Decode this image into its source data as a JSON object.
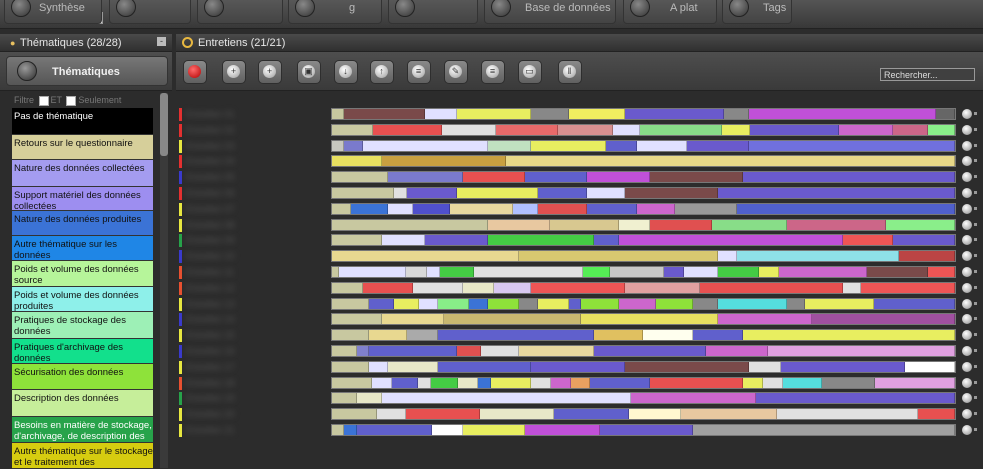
{
  "top": {
    "input_value": "",
    "buttons": [
      {
        "label": "Synthèse"
      },
      {
        "label": ""
      },
      {
        "label": ""
      },
      {
        "label": "g"
      },
      {
        "label": ""
      },
      {
        "label": "Base de données"
      },
      {
        "label": "A plat"
      },
      {
        "label": "Tags"
      }
    ]
  },
  "left": {
    "header": "Thématiques (28/28)",
    "minimize": "-",
    "toolbar_label": "Thématiques",
    "filter_label": "Filtre",
    "filter_and": "ET",
    "filter_only": "Seulement",
    "items": [
      {
        "label": "Pas de thématique",
        "color": "#000000",
        "text": "#ffffff"
      },
      {
        "label": "Retours sur le questionnaire",
        "color": "#d6cf9a",
        "text": "#111111"
      },
      {
        "label": "Nature des données collectées",
        "color": "#a49cf0",
        "text": "#111111"
      },
      {
        "label": "Support matériel des données collectées",
        "color": "#9d8ef0",
        "text": "#111111"
      },
      {
        "label": "Nature des données produites",
        "color": "#3b73d6",
        "text": "#111111"
      },
      {
        "label": "Autre thématique sur les données",
        "color": "#1f86e6",
        "text": "#111111"
      },
      {
        "label": "Poids et volume des données source",
        "color": "#b6f59a",
        "text": "#111111"
      },
      {
        "label": "Poids et volume des données produites",
        "color": "#8ef0ea",
        "text": "#111111"
      },
      {
        "label": "Pratiques de stockage des données",
        "color": "#9df0b6",
        "text": "#111111"
      },
      {
        "label": "Pratiques d'archivage des données",
        "color": "#12e08c",
        "text": "#111111"
      },
      {
        "label": "Sécurisation des données",
        "color": "#8ee23a",
        "text": "#111111"
      },
      {
        "label": "Description des données",
        "color": "#c6ee9a",
        "text": "#111111"
      },
      {
        "label": "Besoins en matière de stockage, d'archivage, de description des",
        "color": "#27a34a",
        "text": "#ffffff"
      },
      {
        "label": "Autre thématique sur le stockage et le traitement des",
        "color": "#d6cc10",
        "text": "#111111"
      }
    ]
  },
  "right": {
    "header": "Entretiens (21/21)",
    "search_placeholder": "Rechercher...",
    "toolbar_icons": [
      "record-icon",
      "zoom-in-icon",
      "add-icon",
      "document-icon",
      "download-icon",
      "upload-icon",
      "list-icon",
      "edit-icon",
      "sort-icon",
      "window-icon",
      "pause-icon"
    ],
    "rows": [
      {
        "marker": "#e53030",
        "name": "Entretien 01",
        "segs": [
          [
            "#c8c8a0",
            2
          ],
          [
            "#7a4a4a",
            13
          ],
          [
            "#e0e0ff",
            5
          ],
          [
            "#e8ee60",
            12
          ],
          [
            "#888",
            6
          ],
          [
            "#f0ee60",
            9
          ],
          [
            "#6a5acd",
            16
          ],
          [
            "#888",
            4
          ],
          [
            "#c050d8",
            30
          ],
          [
            "#666",
            3
          ]
        ]
      },
      {
        "marker": "#e53030",
        "name": "Entretien 02",
        "segs": [
          [
            "#c8c8a0",
            6
          ],
          [
            "#e85050",
            10
          ],
          [
            "#e0e0e0",
            8
          ],
          [
            "#e86a6a",
            9
          ],
          [
            "#d89090",
            8
          ],
          [
            "#e0e0ff",
            4
          ],
          [
            "#88dd88",
            12
          ],
          [
            "#e8ee60",
            4
          ],
          [
            "#6a5acd",
            13
          ],
          [
            "#cc66cc",
            8
          ],
          [
            "#cc6688",
            5
          ],
          [
            "#8aee8a",
            4
          ]
        ]
      },
      {
        "marker": "#e8e840",
        "name": "Entretien 03",
        "segs": [
          [
            "#c8c8c0",
            2
          ],
          [
            "#7a7acc",
            3
          ],
          [
            "#e0e0ff",
            20
          ],
          [
            "#c0e0c0",
            7
          ],
          [
            "#e8ee60",
            12
          ],
          [
            "#6060cc",
            5
          ],
          [
            "#e0e0ff",
            8
          ],
          [
            "#6a5acd",
            10
          ],
          [
            "#7070dd",
            33
          ]
        ]
      },
      {
        "marker": "#e53030",
        "name": "Entretien 04",
        "segs": [
          [
            "#e8e060",
            8
          ],
          [
            "#c8a040",
            20
          ],
          [
            "#e8d888",
            72
          ]
        ]
      },
      {
        "marker": "#3a3acc",
        "name": "Entretien 05",
        "segs": [
          [
            "#c8c8a0",
            9
          ],
          [
            "#7a7acc",
            12
          ],
          [
            "#e85050",
            10
          ],
          [
            "#6060cc",
            10
          ],
          [
            "#c050d8",
            10
          ],
          [
            "#7a4a4a",
            15
          ],
          [
            "#6a5acd",
            34
          ]
        ]
      },
      {
        "marker": "#e53030",
        "name": "Entretien 06",
        "segs": [
          [
            "#c8c8a0",
            10
          ],
          [
            "#e0e0e0",
            2
          ],
          [
            "#6a5acd",
            8
          ],
          [
            "#e8ee60",
            13
          ],
          [
            "#6060cc",
            8
          ],
          [
            "#e0e0ff",
            6
          ],
          [
            "#7a4a4a",
            15
          ],
          [
            "#6a5acd",
            38
          ]
        ]
      },
      {
        "marker": "#e8e840",
        "name": "Entretien 07",
        "segs": [
          [
            "#c8c8a0",
            3
          ],
          [
            "#3b73d6",
            6
          ],
          [
            "#e0e0ff",
            4
          ],
          [
            "#5050cc",
            6
          ],
          [
            "#e8d8a0",
            10
          ],
          [
            "#b0c0ff",
            4
          ],
          [
            "#e05050",
            8
          ],
          [
            "#6060cc",
            8
          ],
          [
            "#cc66cc",
            6
          ],
          [
            "#999",
            10
          ],
          [
            "#5060cc",
            35
          ]
        ]
      },
      {
        "marker": "#e8e840",
        "name": "Entretien 08",
        "segs": [
          [
            "#c8c8a0",
            25
          ],
          [
            "#e8c8a0",
            10
          ],
          [
            "#d8c890",
            11
          ],
          [
            "#f0f0d0",
            5
          ],
          [
            "#e05050",
            10
          ],
          [
            "#88dd88",
            12
          ],
          [
            "#cc6688",
            16
          ],
          [
            "#8aee8a",
            11
          ]
        ]
      },
      {
        "marker": "#27a34a",
        "name": "Entretien 09",
        "segs": [
          [
            "#c8c8a0",
            8
          ],
          [
            "#e0e0ff",
            7
          ],
          [
            "#6a5acd",
            10
          ],
          [
            "#44cc44",
            17
          ],
          [
            "#6060cc",
            4
          ],
          [
            "#c050d8",
            36
          ],
          [
            "#ee5555",
            8
          ],
          [
            "#6a5acd",
            10
          ]
        ]
      },
      {
        "marker": "#3a3acc",
        "name": "Entretien 10",
        "segs": [
          [
            "#e8d890",
            30
          ],
          [
            "#d8c870",
            32
          ],
          [
            "#e0e0ff",
            3
          ],
          [
            "#8ee0e8",
            26
          ],
          [
            "#bb4444",
            9
          ]
        ]
      },
      {
        "marker": "#e85030",
        "name": "Entretien 11",
        "segs": [
          [
            "#c8c8a0",
            1
          ],
          [
            "#e0e0ff",
            10
          ],
          [
            "#d8d8d8",
            3
          ],
          [
            "#e0e0ff",
            2
          ],
          [
            "#44cc44",
            5
          ],
          [
            "#e0e0e0",
            16
          ],
          [
            "#55ee55",
            4
          ],
          [
            "#c8c8c8",
            8
          ],
          [
            "#6a5acd",
            3
          ],
          [
            "#e0e0ff",
            5
          ],
          [
            "#44cc44",
            6
          ],
          [
            "#e8ee60",
            3
          ],
          [
            "#cc66cc",
            13
          ],
          [
            "#7a4a4a",
            9
          ],
          [
            "#ee5555",
            4
          ]
        ]
      },
      {
        "marker": "#e85030",
        "name": "Entretien 12",
        "segs": [
          [
            "#c8c8a0",
            5
          ],
          [
            "#e85050",
            8
          ],
          [
            "#e0e0e0",
            8
          ],
          [
            "#e8e8c8",
            5
          ],
          [
            "#d8c8f0",
            6
          ],
          [
            "#ee5555",
            15
          ],
          [
            "#e0a0a0",
            12
          ],
          [
            "#e85050",
            23
          ],
          [
            "#e0e0e0",
            3
          ],
          [
            "#ee5555",
            15
          ]
        ]
      },
      {
        "marker": "#e8e840",
        "name": "Entretien 13",
        "segs": [
          [
            "#c8c8a0",
            6
          ],
          [
            "#6060cc",
            4
          ],
          [
            "#e8ee60",
            4
          ],
          [
            "#e0e0ff",
            3
          ],
          [
            "#88ee88",
            5
          ],
          [
            "#3b73d6",
            3
          ],
          [
            "#8ee23a",
            5
          ],
          [
            "#888",
            3
          ],
          [
            "#e8ee60",
            5
          ],
          [
            "#6060cc",
            2
          ],
          [
            "#8ee23a",
            6
          ],
          [
            "#cc66cc",
            6
          ],
          [
            "#8ee23a",
            6
          ],
          [
            "#888",
            4
          ],
          [
            "#55dddd",
            11
          ],
          [
            "#888",
            3
          ],
          [
            "#e8ee60",
            11
          ],
          [
            "#6060cc",
            13
          ]
        ]
      },
      {
        "marker": "#3a3acc",
        "name": "Entretien 14",
        "segs": [
          [
            "#c8c8a0",
            8
          ],
          [
            "#e8d890",
            10
          ],
          [
            "#c8b870",
            22
          ],
          [
            "#e8e060",
            22
          ],
          [
            "#cc66cc",
            15
          ],
          [
            "#a050a0",
            23
          ]
        ]
      },
      {
        "marker": "#e8e840",
        "name": "Entretien 15",
        "segs": [
          [
            "#c8c8a0",
            6
          ],
          [
            "#e8d890",
            6
          ],
          [
            "#aaaaaa",
            5
          ],
          [
            "#6060cc",
            25
          ],
          [
            "#e0c060",
            8
          ],
          [
            "#ffffee",
            8
          ],
          [
            "#6060cc",
            8
          ],
          [
            "#e8ee60",
            34
          ]
        ]
      },
      {
        "marker": "#3a3acc",
        "name": "Entretien 16",
        "segs": [
          [
            "#c8c8a0",
            4
          ],
          [
            "#8080cc",
            2
          ],
          [
            "#6060cc",
            14
          ],
          [
            "#e05050",
            4
          ],
          [
            "#e0e0e0",
            6
          ],
          [
            "#e8d8a0",
            12
          ],
          [
            "#6a5acd",
            18
          ],
          [
            "#cc66cc",
            10
          ],
          [
            "#e0a0e0",
            30
          ]
        ]
      },
      {
        "marker": "#e8e840",
        "name": "Entretien 17",
        "segs": [
          [
            "#c8c8a0",
            6
          ],
          [
            "#e0e0ff",
            3
          ],
          [
            "#e8e8c8",
            8
          ],
          [
            "#6060cc",
            15
          ],
          [
            "#6a5acd",
            15
          ],
          [
            "#7a4a4a",
            20
          ],
          [
            "#e0e0e0",
            5
          ],
          [
            "#6a5acd",
            20
          ],
          [
            "#ffffff",
            8
          ]
        ]
      },
      {
        "marker": "#e85030",
        "name": "Entretien 18",
        "segs": [
          [
            "#c8c8a0",
            6
          ],
          [
            "#e0e0ff",
            3
          ],
          [
            "#6060cc",
            4
          ],
          [
            "#e0e0e0",
            2
          ],
          [
            "#44cc44",
            4
          ],
          [
            "#e8e8c8",
            3
          ],
          [
            "#3b73d6",
            2
          ],
          [
            "#e8ee60",
            6
          ],
          [
            "#e0e0e0",
            3
          ],
          [
            "#cc66cc",
            3
          ],
          [
            "#e8a060",
            3
          ],
          [
            "#6060cc",
            9
          ],
          [
            "#e85050",
            14
          ],
          [
            "#e8ee60",
            3
          ],
          [
            "#e0e0e0",
            3
          ],
          [
            "#55dddd",
            6
          ],
          [
            "#888",
            8
          ],
          [
            "#e0a0e0",
            12
          ]
        ]
      },
      {
        "marker": "#27a34a",
        "name": "Entretien 19",
        "segs": [
          [
            "#c8c8a0",
            4
          ],
          [
            "#e8e8c8",
            4
          ],
          [
            "#e0e0ff",
            40
          ],
          [
            "#cc66cc",
            20
          ],
          [
            "#6a5acd",
            32
          ]
        ]
      },
      {
        "marker": "#e8e840",
        "name": "Entretien 20",
        "segs": [
          [
            "#c8c8a0",
            6
          ],
          [
            "#e0e0e0",
            4
          ],
          [
            "#e85050",
            10
          ],
          [
            "#e8e8c8",
            10
          ],
          [
            "#6060cc",
            10
          ],
          [
            "#fff8d0",
            7
          ],
          [
            "#e8c8a0",
            13
          ],
          [
            "#e0e0e0",
            19
          ],
          [
            "#e85050",
            5
          ]
        ]
      },
      {
        "marker": "#e8e840",
        "name": "Entretien 21",
        "segs": [
          [
            "#c8c8a0",
            2
          ],
          [
            "#3b73d6",
            2
          ],
          [
            "#6060cc",
            12
          ],
          [
            "#ffffff",
            5
          ],
          [
            "#e8ee60",
            10
          ],
          [
            "#c050d8",
            12
          ],
          [
            "#6a5acd",
            15
          ],
          [
            "#a0a0a0",
            42
          ]
        ]
      }
    ]
  }
}
